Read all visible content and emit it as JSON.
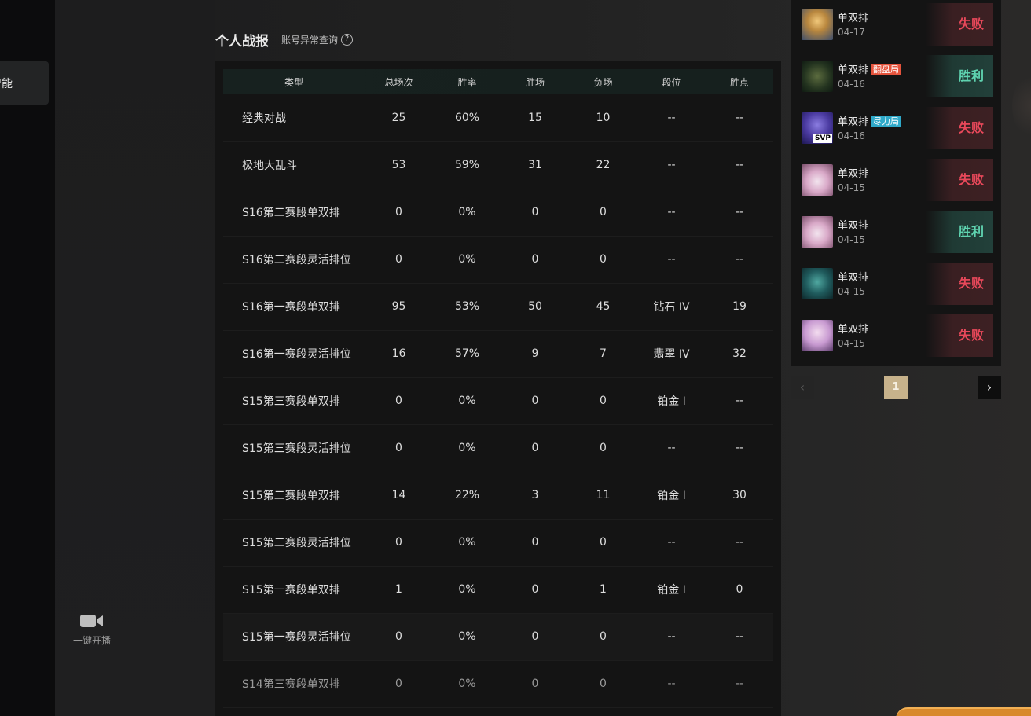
{
  "nav": {
    "active_label": "智能"
  },
  "sidebar": {
    "live_label": "一键开播"
  },
  "header": {
    "title": "个人战报",
    "anomaly_link": "账号异常查询",
    "help_glyph": "?"
  },
  "stats": {
    "columns": [
      "类型",
      "总场次",
      "胜率",
      "胜场",
      "负场",
      "段位",
      "胜点"
    ],
    "rows": [
      [
        "经典对战",
        "25",
        "60%",
        "15",
        "10",
        "--",
        "--"
      ],
      [
        "极地大乱斗",
        "53",
        "59%",
        "31",
        "22",
        "--",
        "--"
      ],
      [
        "S16第二赛段单双排",
        "0",
        "0%",
        "0",
        "0",
        "--",
        "--"
      ],
      [
        "S16第二赛段灵活排位",
        "0",
        "0%",
        "0",
        "0",
        "--",
        "--"
      ],
      [
        "S16第一赛段单双排",
        "95",
        "53%",
        "50",
        "45",
        "钻石 IV",
        "19"
      ],
      [
        "S16第一赛段灵活排位",
        "16",
        "57%",
        "9",
        "7",
        "翡翠 IV",
        "32"
      ],
      [
        "S15第三赛段单双排",
        "0",
        "0%",
        "0",
        "0",
        "铂金 I",
        "--"
      ],
      [
        "S15第三赛段灵活排位",
        "0",
        "0%",
        "0",
        "0",
        "--",
        "--"
      ],
      [
        "S15第二赛段单双排",
        "14",
        "22%",
        "3",
        "11",
        "铂金 I",
        "30"
      ],
      [
        "S15第二赛段灵活排位",
        "0",
        "0%",
        "0",
        "0",
        "--",
        "--"
      ],
      [
        "S15第一赛段单双排",
        "1",
        "0%",
        "0",
        "1",
        "铂金 I",
        "0"
      ],
      [
        "S15第一赛段灵活排位",
        "0",
        "0%",
        "0",
        "0",
        "--",
        "--"
      ],
      [
        "S14第三赛段单双排",
        "0",
        "0%",
        "0",
        "0",
        "--",
        "--"
      ]
    ]
  },
  "matches": [
    {
      "mode": "单双排",
      "tag": "",
      "date": "04-17",
      "result": "失败",
      "outcome": "lose",
      "avatar": "champion-blonde"
    },
    {
      "mode": "单双排",
      "tag": "翻盘局",
      "tag_color": "#e5533c",
      "date": "04-16",
      "result": "胜利",
      "outcome": "win",
      "avatar": "champion-green"
    },
    {
      "mode": "单双排",
      "tag": "尽力局",
      "tag_color": "#2fa9c9",
      "date": "04-16",
      "result": "失败",
      "outcome": "lose",
      "avatar": "champion-purple-svp",
      "badge": "SVP"
    },
    {
      "mode": "单双排",
      "tag": "",
      "date": "04-15",
      "result": "失败",
      "outcome": "lose",
      "avatar": "champion-yordle"
    },
    {
      "mode": "单双排",
      "tag": "",
      "date": "04-15",
      "result": "胜利",
      "outcome": "win",
      "avatar": "champion-yordle"
    },
    {
      "mode": "单双排",
      "tag": "",
      "date": "04-15",
      "result": "失败",
      "outcome": "lose",
      "avatar": "champion-teal"
    },
    {
      "mode": "单双排",
      "tag": "",
      "date": "04-15",
      "result": "失败",
      "outcome": "lose",
      "avatar": "champion-pale"
    }
  ],
  "pager": {
    "current": "1",
    "prev_glyph": "‹",
    "next_glyph": "›"
  },
  "colors": {
    "lose": "#e8485a",
    "win": "#5fd3b0",
    "page_active": "#c7b28b"
  }
}
